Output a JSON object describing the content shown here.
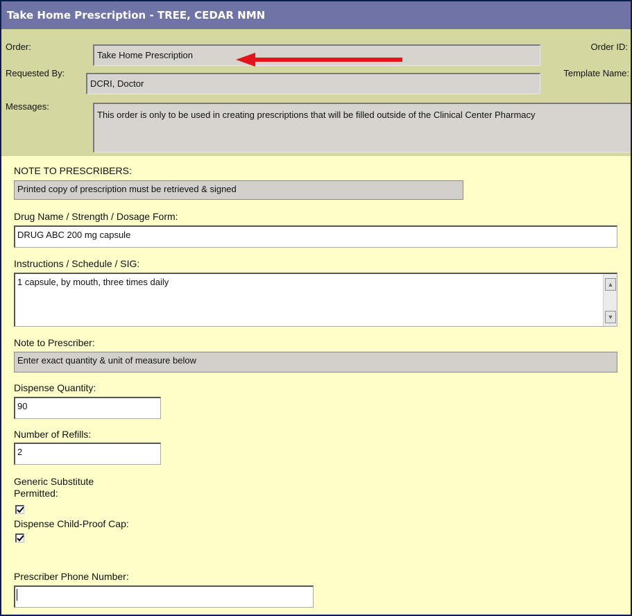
{
  "window": {
    "title": "Take Home Prescription - TREE, CEDAR NMN"
  },
  "header": {
    "order_label": "Order:",
    "order_value": "Take Home Prescription",
    "order_id_label": "Order ID:",
    "requested_by_label": "Requested By:",
    "requested_by_value": "DCRI, Doctor",
    "template_name_label": "Template Name:",
    "messages_label": "Messages:",
    "messages_value": "This order is only to be used in creating prescriptions that will be filled outside of the Clinical Center Pharmacy"
  },
  "form": {
    "note_prescribers_label": "NOTE TO PRESCRIBERS:",
    "note_prescribers_value": "Printed copy of prescription must be retrieved & signed",
    "drug_label": "Drug Name / Strength / Dosage Form:",
    "drug_value": "DRUG ABC 200 mg capsule",
    "instructions_label": "Instructions / Schedule / SIG:",
    "instructions_value": "1 capsule, by mouth, three times daily",
    "note_prescriber_label": "Note to Prescriber:",
    "note_prescriber_value": "Enter exact quantity & unit of measure below",
    "dispense_qty_label": "Dispense Quantity:",
    "dispense_qty_value": "90",
    "refills_label": "Number of Refills:",
    "refills_value": "2",
    "generic_label_line1": "Generic Substitute",
    "generic_label_line2": "Permitted:",
    "generic_checked": true,
    "childproof_label": "Dispense Child-Proof Cap:",
    "childproof_checked": true,
    "phone_label": "Prescriber Phone Number:",
    "phone_value": ""
  },
  "icons": {
    "scroll_up": "scroll-up-arrow-icon",
    "scroll_down": "scroll-down-arrow-icon",
    "checkmark": "checkmark-icon",
    "annotation": "red-arrow-icon"
  },
  "colors": {
    "title_bar": "#6f73a6",
    "header_bg": "#d5d7a0",
    "form_bg": "#fefec8",
    "annotation_arrow": "#e3141b"
  }
}
